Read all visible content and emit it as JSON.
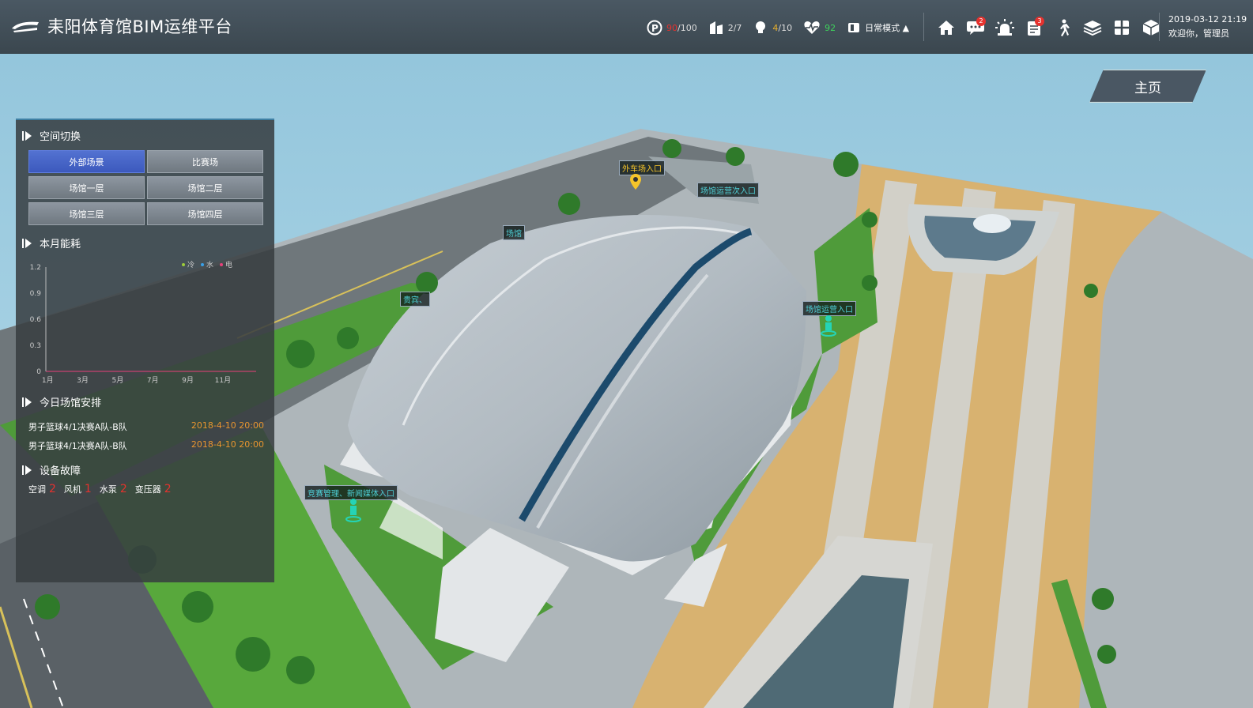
{
  "header": {
    "title": "耒阳体育馆BIM运维平台",
    "parking": {
      "value": "90",
      "total": "/100"
    },
    "venues": {
      "value": "2/7"
    },
    "lights": {
      "value": "4",
      "total": "/10"
    },
    "health": {
      "value": "92"
    },
    "mode": {
      "label": "日常模式 ▲"
    },
    "message_badge": "2",
    "list_badge": "3",
    "datetime": "2019-03-12 21:19",
    "welcome": "欢迎你，管理员"
  },
  "home_button": "主页",
  "panel": {
    "space_switch": {
      "title": "空间切换",
      "buttons": [
        "外部场景",
        "比赛场",
        "场馆一层",
        "场馆二层",
        "场馆三层",
        "场馆四层"
      ],
      "active_index": 0
    },
    "energy": {
      "title": "本月能耗",
      "legend": [
        "冷",
        "水",
        "电"
      ]
    },
    "schedule": {
      "title": "今日场馆安排",
      "rows": [
        {
          "event": "男子篮球4/1决赛A队-B队",
          "time": "2018-4-10 20:00"
        },
        {
          "event": "男子篮球4/1决赛A队-B队",
          "time": "2018-4-10 20:00"
        }
      ]
    },
    "faults": {
      "title": "设备故障",
      "items": [
        {
          "name": "空调",
          "count": "2"
        },
        {
          "name": "风机",
          "count": "1"
        },
        {
          "name": "水泵",
          "count": "2"
        },
        {
          "name": "变压器",
          "count": "2"
        }
      ]
    }
  },
  "chart_data": {
    "type": "line",
    "title": "本月能耗",
    "categories": [
      "1月",
      "3月",
      "5月",
      "7月",
      "9月",
      "11月"
    ],
    "ylim": [
      0,
      1.2
    ],
    "yticks": [
      "0",
      "0.3",
      "0.6",
      "0.9",
      "1.2"
    ],
    "series": [
      {
        "name": "冷",
        "color": "#9ccc3a",
        "values": [
          0,
          0,
          0,
          0,
          0,
          0
        ]
      },
      {
        "name": "水",
        "color": "#3aa0e8",
        "values": [
          0,
          0,
          0,
          0,
          0,
          0
        ]
      },
      {
        "name": "电",
        "color": "#e8407a",
        "values": [
          0,
          0,
          0,
          0,
          0,
          0
        ]
      }
    ],
    "legend_position": "top-right"
  },
  "scene_labels": {
    "visitor_entrance": "外车场入口",
    "ops_secondary_entrance": "场馆运营次入口",
    "ops_entrance": "场馆运营入口",
    "media_entrance": "竞赛管理、新闻媒体入口",
    "vip_entrance": "贵宾、",
    "west_entrance": "场馆"
  },
  "colors": {
    "accent": "#4463c9",
    "alert": "#e5322e",
    "time": "#e8952f",
    "label": "#4fd1d8"
  }
}
